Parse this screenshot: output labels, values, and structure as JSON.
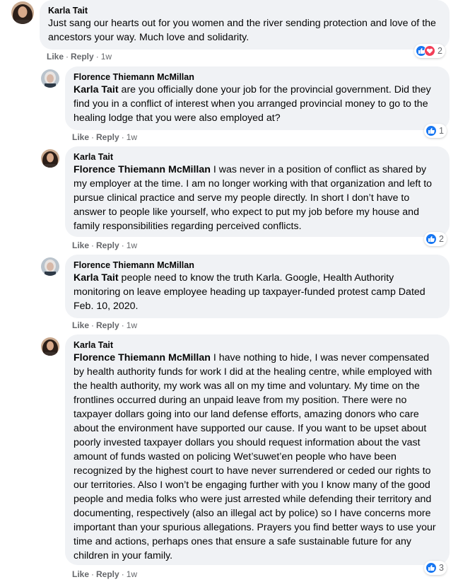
{
  "comments": [
    {
      "author": "Karla Tait",
      "mention": "",
      "text": "Just sang our hearts out for you women and the river sending protection and love of the ancestors your way. Much love and solidarity.",
      "like_label": "Like",
      "reply_label": "Reply",
      "time": "1w",
      "reaction_count": "2",
      "reactions": [
        "like-icon",
        "love-icon"
      ]
    },
    {
      "author": "Florence Thiemann McMillan",
      "mention": "Karla Tait",
      "text": " are you officially done your job for the provincial government. Did they find you in a conflict of interest when you arranged provincial money to go to the healing lodge that you were also employed at?",
      "like_label": "Like",
      "reply_label": "Reply",
      "time": "1w",
      "reaction_count": "1",
      "reactions": [
        "like-icon"
      ]
    },
    {
      "author": "Karla Tait",
      "mention": "Florence Thiemann McMillan",
      "text": " I was never in a position of conflict as shared by my employer at the time. I am no longer working with that organization and left to pursue clinical practice and serve my people directly. In short I don’t have to answer to people like yourself, who expect to put my job before my house and family responsibilities regarding perceived conflicts.",
      "like_label": "Like",
      "reply_label": "Reply",
      "time": "1w",
      "reaction_count": "2",
      "reactions": [
        "like-icon"
      ]
    },
    {
      "author": "Florence Thiemann McMillan",
      "mention": "Karla Tait",
      "text": " people need to know the truth Karla. Google, Health Authority monitoring on leave employee heading up taxpayer-funded protest camp Dated Feb. 10, 2020.",
      "like_label": "Like",
      "reply_label": "Reply",
      "time": "1w",
      "reaction_count": "",
      "reactions": []
    },
    {
      "author": "Karla Tait",
      "mention": "Florence Thiemann McMillan",
      "text": " I have nothing to hide, I was never compensated by health authority funds for work I did at the healing centre, while employed with the health authority, my work was all on my time and voluntary. My time on the frontlines occurred during an unpaid leave from my position. There were no taxpayer dollars going into our land defense efforts, amazing donors who care about the environment have supported our cause. If you want to be upset about poorly invested taxpayer dollars you should request information about the vast amount of funds wasted on policing Wet’suwet’en people who have been recognized by the highest court to have never surrendered or ceded our rights to our territories. Also I won’t be engaging further with you I know many of the good people and media folks who were just arrested while defending their territory and documenting, respectively (also an illegal act by police) so I have concerns more important than your spurious allegations. Prayers you find better ways to use your time and actions, perhaps ones that ensure a safe sustainable future for any children in your family.",
      "like_label": "Like",
      "reply_label": "Reply",
      "time": "1w",
      "reaction_count": "3",
      "reactions": [
        "like-icon"
      ]
    }
  ],
  "colors": {
    "bubble": "#f0f2f5",
    "secondary_text": "#65676b",
    "like_blue": "#1877f2",
    "love_red": "#f33e58"
  }
}
